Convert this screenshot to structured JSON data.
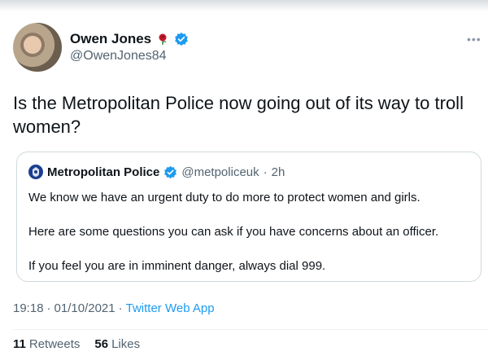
{
  "tweet": {
    "author_name": "Owen Jones",
    "author_handle": "@OwenJones84",
    "text": "Is the Metropolitan Police now going out of its way to troll women?",
    "time": "19:18",
    "date": "01/10/2021",
    "source": "Twitter Web App",
    "retweets_count": "11",
    "retweets_label": "Retweets",
    "likes_count": "56",
    "likes_label": "Likes",
    "icons": {
      "more": "more-icon",
      "verified": "verified-badge-icon",
      "rose": "rose-emoji-icon"
    }
  },
  "quoted": {
    "author_name": "Metropolitan Police",
    "author_handle": "@metpoliceuk",
    "age": "2h",
    "lines": [
      "We know we have an urgent duty to do more to protect women and girls.",
      "Here are some questions you can ask if you have concerns about an officer.",
      "If you feel you are in imminent danger, always dial 999."
    ]
  },
  "colors": {
    "accent": "#1d9bf0",
    "muted": "#536471",
    "text": "#0f1419"
  }
}
